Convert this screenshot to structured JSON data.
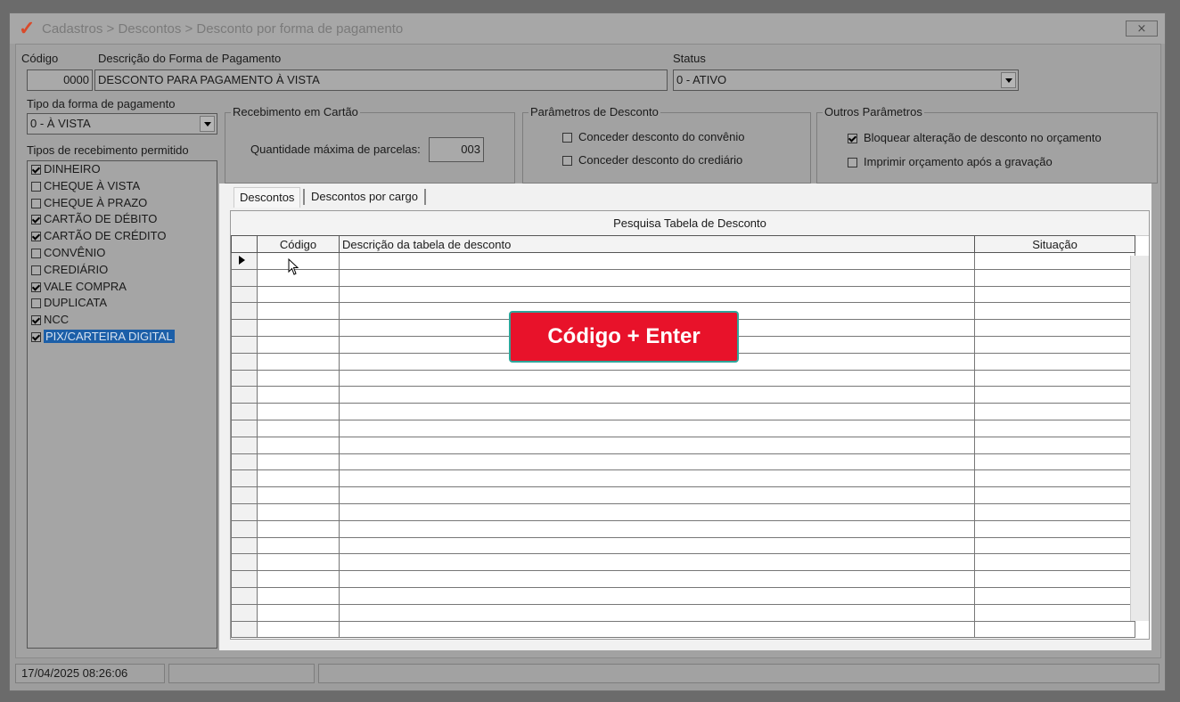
{
  "window": {
    "title": "Cadastros > Descontos > Desconto por forma de pagamento",
    "close_label": "⨯"
  },
  "form": {
    "codigo_label": "Código",
    "codigo_value": "0000",
    "descricao_label": "Descrição do Forma de Pagamento",
    "descricao_value": "DESCONTO PARA PAGAMENTO À VISTA",
    "status_label": "Status",
    "status_value": "0 - ATIVO",
    "tipo_label": "Tipo da forma de pagamento",
    "tipo_value": "0 - À VISTA",
    "tipos_receb_label": "Tipos de recebimento permitido"
  },
  "receb_items": [
    {
      "label": "DINHEIRO",
      "checked": true
    },
    {
      "label": "CHEQUE À VISTA",
      "checked": false
    },
    {
      "label": "CHEQUE À PRAZO",
      "checked": false
    },
    {
      "label": "CARTÃO DE DÉBITO",
      "checked": true
    },
    {
      "label": "CARTÃO DE CRÉDITO",
      "checked": true
    },
    {
      "label": "CONVÊNIO",
      "checked": false
    },
    {
      "label": "CREDIÁRIO",
      "checked": false
    },
    {
      "label": "VALE COMPRA",
      "checked": true
    },
    {
      "label": "DUPLICATA",
      "checked": false
    },
    {
      "label": "NCC",
      "checked": true
    },
    {
      "label": "PIX/CARTEIRA DIGITAL",
      "checked": true,
      "selected": true
    }
  ],
  "cartao": {
    "title": "Recebimento em Cartão",
    "parcelas_label": "Quantidade máxima de parcelas:",
    "parcelas_value": "003"
  },
  "param_desconto": {
    "title": "Parâmetros de Desconto",
    "convenio_label": "Conceder desconto do convênio",
    "convenio_checked": false,
    "crediario_label": "Conceder desconto do crediário",
    "crediario_checked": false
  },
  "outros": {
    "title": "Outros Parâmetros",
    "bloquear_label": "Bloquear alteração de desconto no orçamento",
    "bloquear_checked": true,
    "imprimir_label": "Imprimir orçamento após a gravação",
    "imprimir_checked": false
  },
  "tabs": [
    {
      "label": "Descontos",
      "active": true
    },
    {
      "label": "Descontos por cargo",
      "active": false
    }
  ],
  "grid": {
    "caption": "Pesquisa Tabela de Desconto",
    "columns": [
      "Código",
      "Descrição da tabela de desconto",
      "Situação"
    ],
    "rows": []
  },
  "overlay": {
    "text": "Código + Enter"
  },
  "statusbar": {
    "datetime": "17/04/2025 08:26:06",
    "cell2": "",
    "cell3": ""
  }
}
